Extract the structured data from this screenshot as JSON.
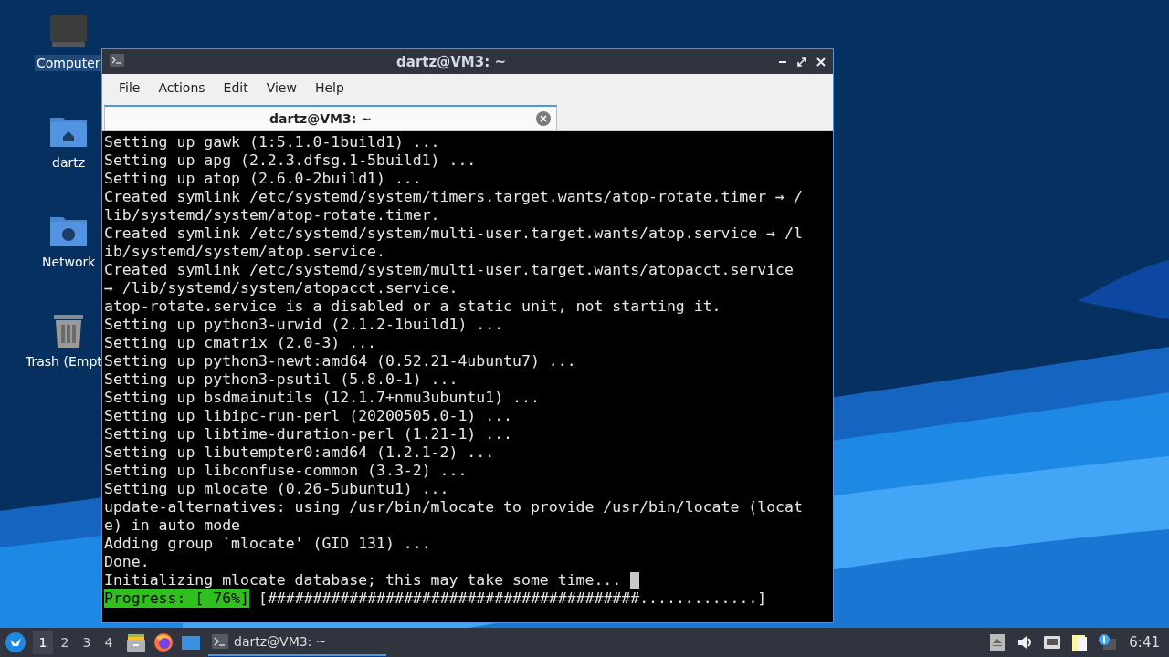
{
  "desktop_icons": [
    {
      "label": "Computer",
      "kind": "computer",
      "selected": true
    },
    {
      "label": "dartz",
      "kind": "home",
      "selected": false
    },
    {
      "label": "Network",
      "kind": "network",
      "selected": false
    },
    {
      "label": "Trash (Empt",
      "kind": "trash",
      "selected": false
    }
  ],
  "window": {
    "title": "dartz@VM3: ~",
    "menu": [
      "File",
      "Actions",
      "Edit",
      "View",
      "Help"
    ],
    "tabs": [
      {
        "label": "dartz@VM3: ~",
        "selected": true
      }
    ],
    "terminal": [
      {
        "kind": "text",
        "text": "Setting up gawk (1:5.1.0-1build1) ..."
      },
      {
        "kind": "text",
        "text": "Setting up apg (2.2.3.dfsg.1-5build1) ..."
      },
      {
        "kind": "text",
        "text": "Setting up atop (2.6.0-2build1) ..."
      },
      {
        "kind": "text",
        "text": "Created symlink /etc/systemd/system/timers.target.wants/atop-rotate.timer → /"
      },
      {
        "kind": "text",
        "text": "lib/systemd/system/atop-rotate.timer."
      },
      {
        "kind": "text",
        "text": "Created symlink /etc/systemd/system/multi-user.target.wants/atop.service → /l"
      },
      {
        "kind": "text",
        "text": "ib/systemd/system/atop.service."
      },
      {
        "kind": "text",
        "text": "Created symlink /etc/systemd/system/multi-user.target.wants/atopacct.service"
      },
      {
        "kind": "text",
        "text": "→ /lib/systemd/system/atopacct.service."
      },
      {
        "kind": "text",
        "text": "atop-rotate.service is a disabled or a static unit, not starting it."
      },
      {
        "kind": "text",
        "text": "Setting up python3-urwid (2.1.2-1build1) ..."
      },
      {
        "kind": "text",
        "text": "Setting up cmatrix (2.0-3) ..."
      },
      {
        "kind": "text",
        "text": "Setting up python3-newt:amd64 (0.52.21-4ubuntu7) ..."
      },
      {
        "kind": "text",
        "text": "Setting up python3-psutil (5.8.0-1) ..."
      },
      {
        "kind": "text",
        "text": "Setting up bsdmainutils (12.1.7+nmu3ubuntu1) ..."
      },
      {
        "kind": "text",
        "text": "Setting up libipc-run-perl (20200505.0-1) ..."
      },
      {
        "kind": "text",
        "text": "Setting up libtime-duration-perl (1.21-1) ..."
      },
      {
        "kind": "text",
        "text": "Setting up libutempter0:amd64 (1.2.1-2) ..."
      },
      {
        "kind": "text",
        "text": "Setting up libconfuse-common (3.3-2) ..."
      },
      {
        "kind": "text",
        "text": "Setting up mlocate (0.26-5ubuntu1) ..."
      },
      {
        "kind": "text",
        "text": "update-alternatives: using /usr/bin/mlocate to provide /usr/bin/locate (locat"
      },
      {
        "kind": "text",
        "text": "e) in auto mode"
      },
      {
        "kind": "text",
        "text": "Adding group `mlocate' (GID 131) ..."
      },
      {
        "kind": "text",
        "text": "Done."
      },
      {
        "kind": "cursor",
        "text": "Initializing mlocate database; this may take some time..."
      },
      {
        "kind": "progress",
        "label": "Progress: [ 76%]",
        "bar": "[#########################################.............]"
      }
    ]
  },
  "taskbar": {
    "workspaces": [
      {
        "label": "1",
        "selected": true
      },
      {
        "label": "2",
        "selected": false
      },
      {
        "label": "3",
        "selected": false
      },
      {
        "label": "4",
        "selected": false
      }
    ],
    "launchers": [
      {
        "kind": "files"
      },
      {
        "kind": "browser"
      },
      {
        "kind": "desktop"
      }
    ],
    "tasks": [
      {
        "label": "dartz@VM3: ~",
        "selected": true
      }
    ],
    "tray": [
      {
        "kind": "eject"
      },
      {
        "kind": "volume"
      },
      {
        "kind": "network"
      },
      {
        "kind": "notes"
      },
      {
        "kind": "notice"
      }
    ],
    "clock": "6:41"
  }
}
